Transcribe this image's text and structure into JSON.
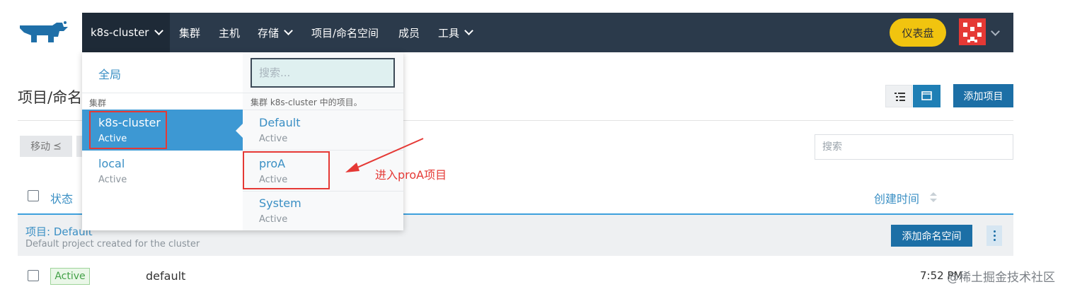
{
  "nav": {
    "cluster": "k8s-cluster",
    "items": [
      "集群",
      "主机",
      "存储",
      "项目/命名空间",
      "成员",
      "工具"
    ],
    "dashboard": "仪表盘"
  },
  "page": {
    "title": "项目/命名空间",
    "add_project": "添加项目",
    "move": "移动",
    "search_placeholder": "搜索",
    "col_status": "状态",
    "col_created": "创建时间",
    "group_title": "项目: Default",
    "group_desc": "Default project created for the cluster",
    "add_namespace": "添加命名空间",
    "row": {
      "status": "Active",
      "name": "default",
      "time": "7:52 PM"
    }
  },
  "dropdown": {
    "global": "全局",
    "cluster_section": "集群",
    "clusters": [
      {
        "name": "k8s-cluster",
        "state": "Active"
      },
      {
        "name": "local",
        "state": "Active"
      }
    ],
    "search_placeholder": "搜索...",
    "projects_hint": "集群 k8s-cluster 中的项目。",
    "projects": [
      {
        "name": "Default",
        "state": "Active"
      },
      {
        "name": "proA",
        "state": "Active"
      },
      {
        "name": "System",
        "state": "Active"
      }
    ]
  },
  "annotation": "进入proA项目",
  "watermark": "@稀土掘金技术社区",
  "colors": {
    "nav_bg": "#2b3a4b",
    "accent": "#3d98d3",
    "primary_btn": "#1c6fa6",
    "dashboard": "#f1c40f",
    "annotation": "#e53935"
  }
}
